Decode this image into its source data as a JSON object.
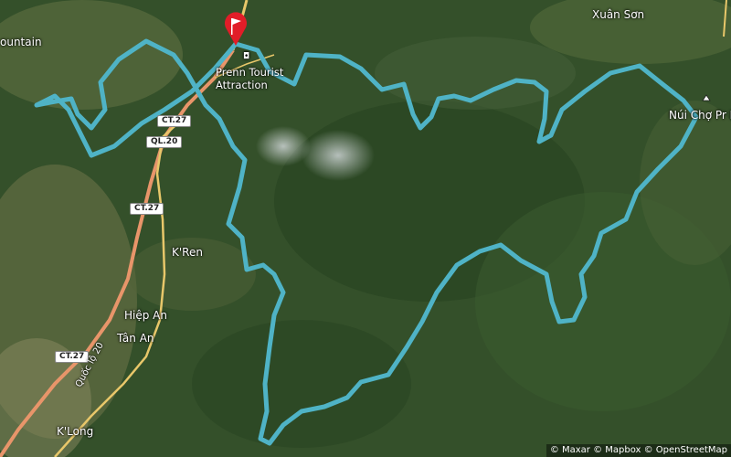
{
  "map": {
    "places": [
      "Xuân Sơn",
      "ountain",
      "Núi Chợ Pr Li",
      "K'Ren",
      "Hiệp An",
      "Tân An",
      "K'Long"
    ],
    "attraction": {
      "name": "Prenn Tourist Attraction",
      "icon": "camera-icon"
    },
    "road_shields": [
      "CT.27",
      "QL.20",
      "CT.27",
      "CT.27"
    ],
    "road_name": "Quốc lộ 20",
    "start_marker_icon": "flag-marker-icon",
    "peak_icon": "mountain-peak-icon",
    "route_color": "#4fb3c6",
    "attribution": "© Maxar © Mapbox © OpenStreetMap"
  }
}
